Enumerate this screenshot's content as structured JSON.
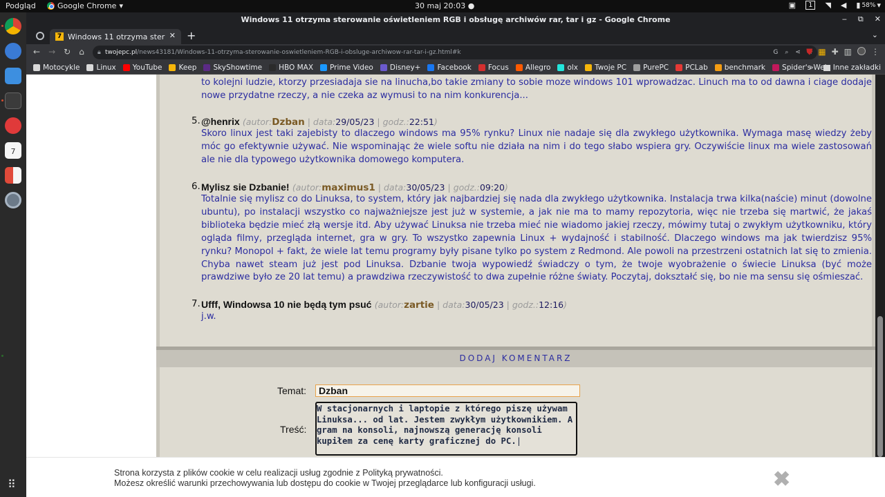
{
  "top_panel": {
    "activities": "Podgląd",
    "app_name": "Google Chrome",
    "clock": "30 maj  20:03",
    "workspace": "1",
    "battery": "58%"
  },
  "window": {
    "title": "Windows 11 otrzyma sterowanie oświetleniem RGB i obsługę archiwów rar, tar i gz - Google Chrome"
  },
  "tab": {
    "favicon": "7",
    "label": "Windows 11 otrzyma ster"
  },
  "omnibox": {
    "domain": "twojepc.pl",
    "path": "/news43181/Windows-11-otrzyma-sterowanie-oswietleniem-RGB-i-obsluge-archiwow-rar-tar-i-gz.html#k"
  },
  "bookmarks": [
    {
      "label": "Motocykle",
      "color": "#d9d9d9"
    },
    {
      "label": "Linux",
      "color": "#d9d9d9"
    },
    {
      "label": "YouTube",
      "color": "#ff0000"
    },
    {
      "label": "Keep",
      "color": "#f6b60a"
    },
    {
      "label": "SkyShowtime",
      "color": "#5b2a86"
    },
    {
      "label": "HBO MAX",
      "color": "#2b2b2b"
    },
    {
      "label": "Prime Video",
      "color": "#1a98ff"
    },
    {
      "label": "Disney+",
      "color": "#6b5acd"
    },
    {
      "label": "Facebook",
      "color": "#1877f2"
    },
    {
      "label": "Focus",
      "color": "#d32f2f"
    },
    {
      "label": "Allegro",
      "color": "#ff5a00"
    },
    {
      "label": "olx",
      "color": "#23e5db"
    },
    {
      "label": "Twoje PC",
      "color": "#f6b60a"
    },
    {
      "label": "PurePC",
      "color": "#9e9e9e"
    },
    {
      "label": "PCLab",
      "color": "#e53935"
    },
    {
      "label": "benchmark",
      "color": "#f39c12"
    },
    {
      "label": "Spider's Web",
      "color": "#c2185b"
    }
  ],
  "bookmarks_more": "»",
  "bookmarks_other": "Inne zakładki",
  "partial_comment": "to kolejni ludzie, ktorzy przesiadaja sie na linucha,bo takie zmiany to sobie moze windows 101 wprowadzac. Linuch ma to od dawna i ciage dodaje nowe przydatne rzeczy, a nie czeka az wymusi to na nim konkurencja...",
  "labels": {
    "author": "autor:",
    "date": "data:",
    "time": "godz.:"
  },
  "comments": [
    {
      "num": "5.",
      "subject": "@henrix",
      "author": "Dzban",
      "date": "29/05/23",
      "time": "22:51",
      "body": "Skoro linux jest taki zajebisty to dlaczego windows ma 95% rynku? Linux nie nadaje się dla zwykłego użytkownika. Wymaga masę wiedzy żeby móc go efektywnie używać. Nie wspominając że wiele softu nie działa na nim i do tego słabo wspiera gry. Oczywiście linux ma wiele zastosowań ale nie dla typowego użytkownika domowego komputera."
    },
    {
      "num": "6.",
      "subject": "Mylisz sie Dzbanie!",
      "author": "maximus1",
      "date": "30/05/23",
      "time": "09:20",
      "body": "Totalnie się mylisz co do Linuksa, to system, który jak najbardziej się nada dla zwykłego użytkownika. Instalacja trwa kilka(naście) minut (dowolne ubuntu), po instalacji wszystko co najważniejsze jest już w systemie, a jak nie ma to mamy repozytoria, więc nie trzeba się martwić, że jakaś biblioteka będzie mieć złą wersje itd. Aby używać Linuksa nie trzeba mieć nie wiadomo jakiej rzeczy, mówimy tutaj o zwykłym użytkowniku, który ogląda filmy, przegląda internet, gra w gry. To wszystko zapewnia Linux + wydajność i stabilność. Dlaczego windows ma jak twierdzisz 95% rynku? Monopol + fakt, że wiele lat temu programy były pisane tylko po system z Redmond. Ale powoli na przestrzeni ostatnich lat się to zmienia. Chyba nawet steam już jest pod Linuksa. Dzbanie twoja wypowiedź świadczy o tym, że twoje wyobrażenie o świecie Linuksa (być może prawdziwe było ze 20 lat temu) a prawdziwa rzeczywistość to dwa zupełnie różne światy. Poczytaj, dokształć się, bo nie ma sensu się ośmieszać."
    },
    {
      "num": "7.",
      "subject": "Ufff, Windowsa 10 nie będą tym psuć",
      "author": "zartie",
      "date": "30/05/23",
      "time": "12:16",
      "body": "j.w."
    }
  ],
  "add_comment": {
    "heading": "DODAJ KOMENTARZ",
    "subject_label": "Temat:",
    "subject_value": "Dzban",
    "content_label": "Treść:",
    "content_lines": [
      "W stacjonarnych i laptopie z którego piszę używam",
      "Linuksa... od lat. Jestem zwykłym użytkownikiem. A",
      "gram na konsoli, najnowszą generację konsoli",
      "kupiłem za cenę karty graficznej do PC."
    ]
  },
  "cookie": {
    "line1": "Strona korzysta z plików cookie w celu realizacji usług zgodnie z Polityką prywatności.",
    "line2": "Możesz określić warunki przechowywania lub dostępu do cookie w Twojej przeglądarce lub konfiguracji usługi.",
    "close": "✖"
  }
}
